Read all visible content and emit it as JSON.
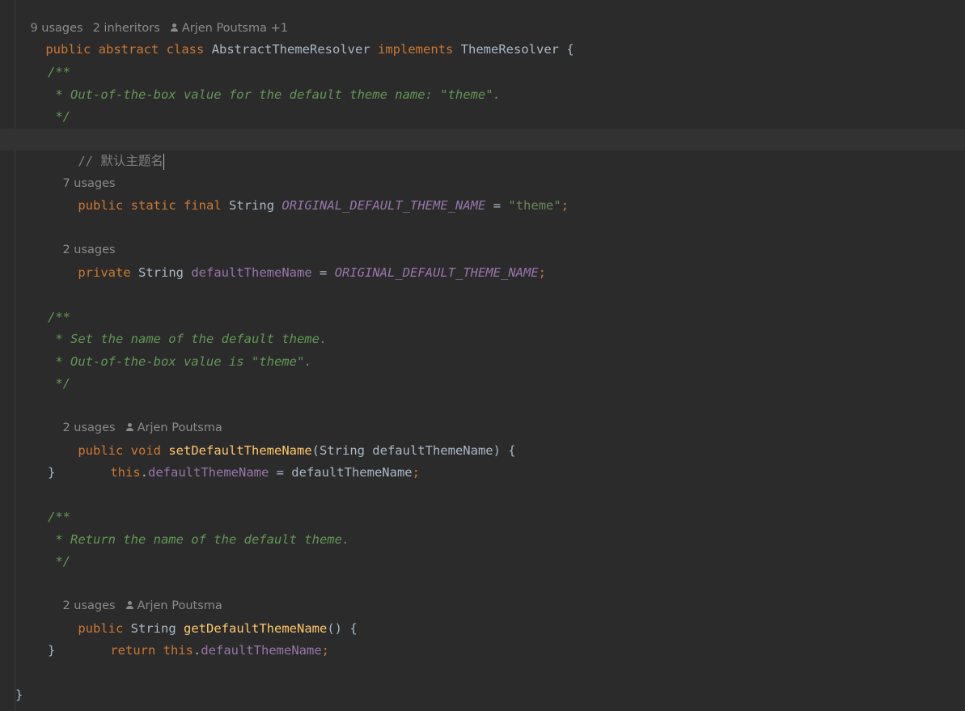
{
  "code": {
    "class_lens": {
      "usages": "9 usages",
      "inheritors": "2 inheritors",
      "authors": "Arjen Poutsma +1"
    },
    "class_decl": {
      "kw_public": "public",
      "kw_abstract": "abstract",
      "kw_class": "class",
      "class_name": "AbstractThemeResolver",
      "kw_implements": "implements",
      "interface_name": "ThemeResolver",
      "open_brace": "{"
    },
    "doc1": {
      "open": "/**",
      "text": " * Out-of-the-box value for the default theme name: \"theme\".",
      "close": " */"
    },
    "comment_line": "// 默认主题名",
    "const_lens": {
      "usages": "7 usages"
    },
    "const_decl": {
      "kw_public": "public",
      "kw_static": "static",
      "kw_final": "final",
      "type": "String",
      "name": "ORIGINAL_DEFAULT_THEME_NAME",
      "eq": "=",
      "value": "\"theme\"",
      "semi": ";"
    },
    "field_lens": {
      "usages": "2 usages"
    },
    "field_decl": {
      "kw_private": "private",
      "type": "String",
      "name": "defaultThemeName",
      "eq": "=",
      "value": "ORIGINAL_DEFAULT_THEME_NAME",
      "semi": ";"
    },
    "doc2": {
      "open": "/**",
      "line1": " * Set the name of the default theme.",
      "line2": " * Out-of-the-box value is \"theme\".",
      "close": " */"
    },
    "setter_lens": {
      "usages": "2 usages",
      "author": "Arjen Poutsma"
    },
    "setter_decl": {
      "kw_public": "public",
      "kw_void": "void",
      "name": "setDefaultThemeName",
      "params": "(String defaultThemeName) {",
      "body_this": "this",
      "dot": ".",
      "body_field": "defaultThemeName",
      "body_rest": " = defaultThemeName",
      "semi": ";",
      "close": "}"
    },
    "doc3": {
      "open": "/**",
      "text": " * Return the name of the default theme.",
      "close": " */"
    },
    "getter_lens": {
      "usages": "2 usages",
      "author": "Arjen Poutsma"
    },
    "getter_decl": {
      "kw_public": "public",
      "type": "String",
      "name": "getDefaultThemeName",
      "params": "() {",
      "kw_return": "return",
      "body_this": "this",
      "dot": ".",
      "body_field": "defaultThemeName",
      "semi": ";",
      "close": "}"
    },
    "class_close": "}"
  },
  "colors": {
    "background": "#2b2b2b",
    "current_line": "#323232",
    "keyword": "#cc7832",
    "field": "#9876aa",
    "string": "#6a8759",
    "method": "#ffc66d",
    "doc_comment": "#629755",
    "comment": "#808080",
    "text": "#a9b7c6",
    "lens": "#8b8b8b"
  }
}
